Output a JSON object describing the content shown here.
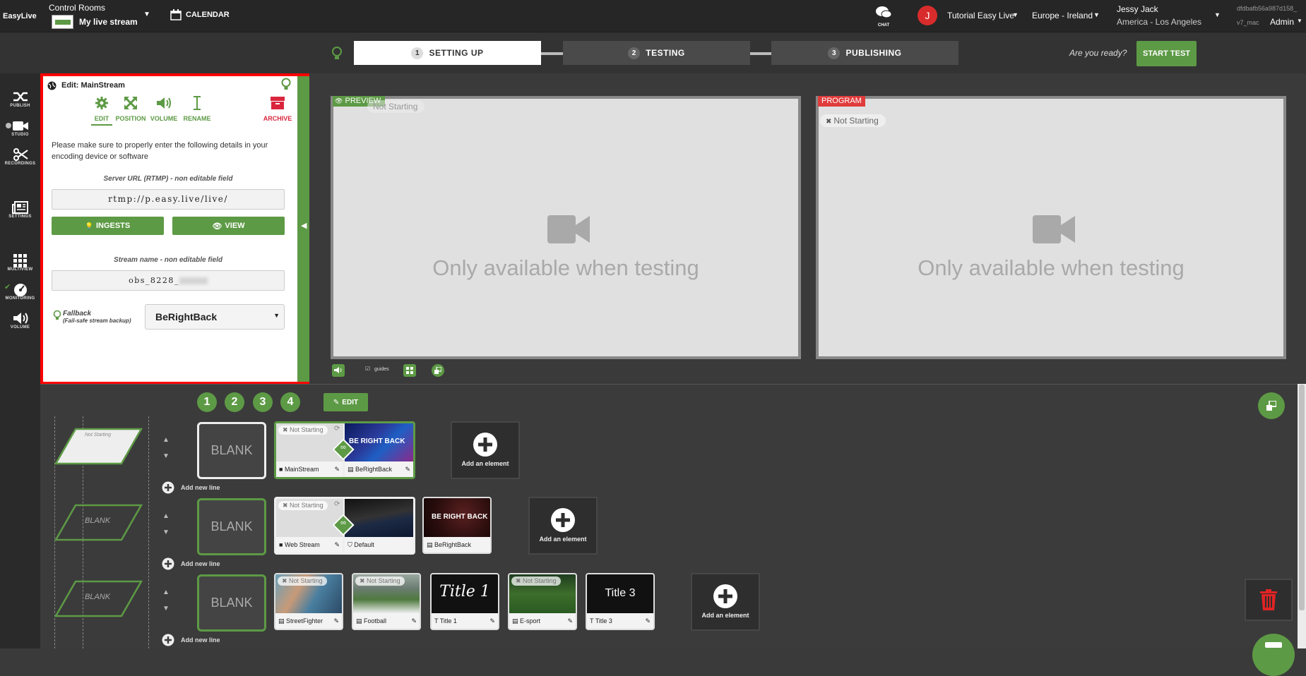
{
  "brand": {
    "logo_text": "EasyLive"
  },
  "header": {
    "control_rooms_label": "Control Rooms",
    "stream_name": "My live stream",
    "calendar_label": "CALENDAR",
    "chat_label": "CHAT",
    "user_initial": "J",
    "tutorial_label": "Tutorial Easy Live",
    "region_label": "Europe - Ireland",
    "user_name": "Jessy Jack",
    "timezone": "America - Los Angeles",
    "session_id": "dfdbafb56a987d158_",
    "version": "v7_mac",
    "role_label": "Admin"
  },
  "steps": [
    {
      "num": "1",
      "label": "SETTING UP"
    },
    {
      "num": "2",
      "label": "TESTING"
    },
    {
      "num": "3",
      "label": "PUBLISHING"
    }
  ],
  "ready_text": "Are you ready?",
  "start_test_label": "START TEST",
  "nav": [
    {
      "label": "PUBLISH"
    },
    {
      "label": "STUDIO"
    },
    {
      "label": "RECORDINGS"
    },
    {
      "label": "SETTINGS"
    },
    {
      "label": "MULTIVIEW"
    },
    {
      "label": "MONITORING"
    },
    {
      "label": "VOLUME"
    }
  ],
  "edit_panel": {
    "title": "Edit: MainStream",
    "tabs": [
      {
        "label": "EDIT"
      },
      {
        "label": "POSITION"
      },
      {
        "label": "VOLUME"
      },
      {
        "label": "RENAME"
      },
      {
        "label": "ARCHIVE"
      }
    ],
    "instructions": "Please make sure to properly enter the following details in your encoding device or software",
    "server_url_label": "Server URL (RTMP) - non editable field",
    "server_url": "rtmp://p.easy.live/live/",
    "ingests_label": "INGESTS",
    "view_label": "VIEW",
    "stream_name_label": "Stream name - non editable field",
    "stream_key": "obs_8228_",
    "fallback_label": "Fallback",
    "fallback_sub": "(Fail-safe stream backup)",
    "fallback_value": "BeRightBack"
  },
  "preview": {
    "badge": "PREVIEW",
    "status": "Not Starting",
    "message": "Only available when testing"
  },
  "program": {
    "badge": "PROGRAM",
    "status": "Not Starting",
    "message": "Only available when testing"
  },
  "guides_label": "guides",
  "scene_tabs": [
    "1",
    "2",
    "3",
    "4"
  ],
  "scenes_edit_label": "EDIT",
  "blank_label": "BLANK",
  "add_element_label": "Add an element",
  "add_new_line_label": "Add new line",
  "not_starting": "Not Starting",
  "rows": [
    {
      "layout_label": "Not Starting",
      "items": [
        {
          "label": "MainStream"
        },
        {
          "label": "BeRightBack",
          "thumb_text": "BE RIGHT BACK"
        }
      ]
    },
    {
      "layout_label": "BLANK",
      "items": [
        {
          "label": "Web Stream"
        },
        {
          "label": "Default"
        },
        {
          "label": "BeRightBack",
          "thumb_text": "BE RIGHT BACK"
        }
      ]
    },
    {
      "layout_label": "BLANK",
      "items": [
        {
          "label": "StreetFighter"
        },
        {
          "label": "Football"
        },
        {
          "label": "Title 1",
          "thumb_text": "Title 1"
        },
        {
          "label": "E-sport"
        },
        {
          "label": "Title 3",
          "thumb_text": "Title 3"
        }
      ]
    }
  ],
  "colors": {
    "accent": "#5d9a45",
    "danger": "#e02424",
    "program": "#e03c3c",
    "highlight": "#ff0000"
  }
}
